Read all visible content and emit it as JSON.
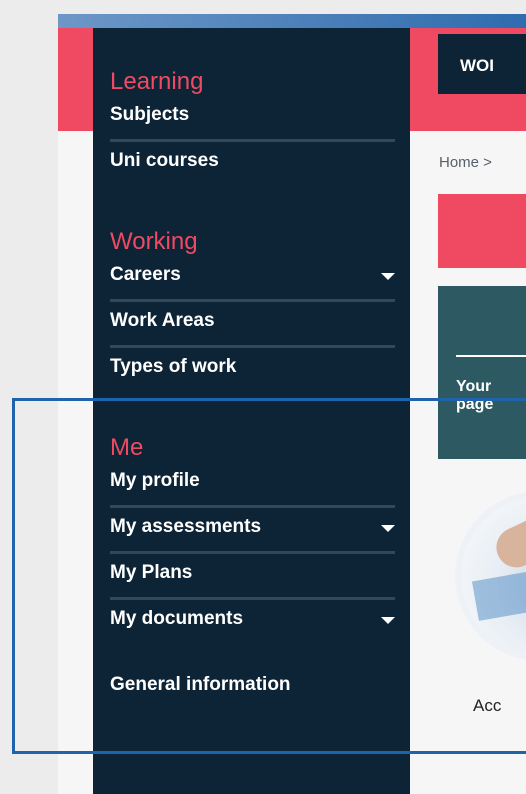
{
  "header": {
    "work_button_label": "WOI",
    "breadcrumb": "Home >"
  },
  "teal_card": {
    "text_line1": "Your",
    "text_line2": "page"
  },
  "card": {
    "caption": "Acc"
  },
  "sidebar": {
    "sections": [
      {
        "heading": "Learning",
        "items": [
          {
            "label": "Subjects",
            "has_dropdown": false
          },
          {
            "label": "Uni courses",
            "has_dropdown": false
          }
        ]
      },
      {
        "heading": "Working",
        "items": [
          {
            "label": "Careers",
            "has_dropdown": true
          },
          {
            "label": "Work Areas",
            "has_dropdown": false
          },
          {
            "label": "Types of work",
            "has_dropdown": false
          }
        ]
      },
      {
        "heading": "Me",
        "items": [
          {
            "label": "My profile",
            "has_dropdown": false
          },
          {
            "label": "My assessments",
            "has_dropdown": true
          },
          {
            "label": "My Plans",
            "has_dropdown": false
          },
          {
            "label": "My documents",
            "has_dropdown": true
          },
          {
            "label": "General information",
            "has_dropdown": false
          }
        ]
      }
    ]
  },
  "colors": {
    "sidebar_bg": "#0d2436",
    "accent_pink": "#ef4a62",
    "divider": "#2d4b56",
    "teal": "#2d5a62",
    "highlight": "#1f63ad"
  }
}
